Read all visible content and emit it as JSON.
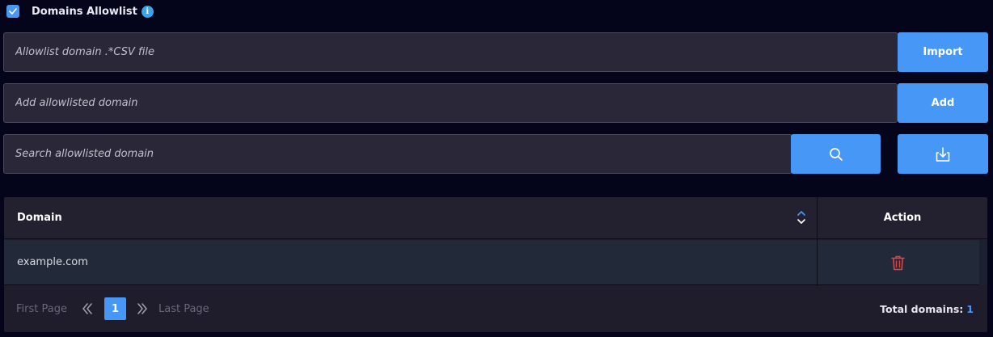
{
  "header": {
    "title": "Domains Allowlist",
    "checked": true,
    "info_glyph": "i"
  },
  "import_section": {
    "placeholder": "Allowlist domain .*CSV file",
    "button_label": "Import"
  },
  "add_section": {
    "placeholder": "Add allowlisted domain",
    "button_label": "Add"
  },
  "search_section": {
    "placeholder": "Search allowlisted domain",
    "search_icon": "search-icon",
    "download_icon": "download-icon"
  },
  "table": {
    "columns": [
      "Domain",
      "Action"
    ],
    "rows": [
      {
        "domain": "example.com",
        "action_icon": "trash-icon"
      }
    ]
  },
  "pagination": {
    "first_label": "First Page",
    "last_label": "Last Page",
    "current_page": "1",
    "total_label": "Total domains:",
    "total_count": "1"
  },
  "colors": {
    "accent": "#4797f7",
    "background": "#04051a",
    "danger": "#e5413f"
  }
}
